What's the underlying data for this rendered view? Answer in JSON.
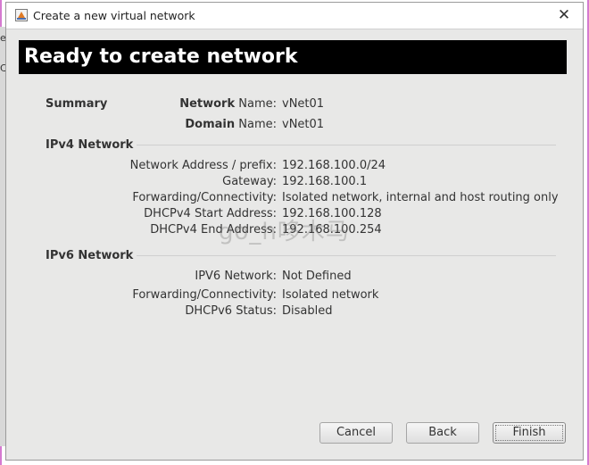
{
  "window": {
    "title": "Create a new virtual network",
    "close_glyph": "✕"
  },
  "behind": {
    "chars": [
      "e",
      "C",
      "(",
      "a",
      "t"
    ]
  },
  "header": {
    "title": "Ready to create network"
  },
  "summary": {
    "section": "Summary",
    "network_label_bold": "Network",
    "network_label_rest": " Name:",
    "network_name": "vNet01",
    "domain_label_bold": "Domain",
    "domain_label_rest": " Name:",
    "domain_name": "vNet01"
  },
  "ipv4": {
    "section": "IPv4 Network",
    "rows": [
      {
        "label": "Network Address / prefix:",
        "value": "192.168.100.0/24"
      },
      {
        "label": "Gateway:",
        "value": "192.168.100.1"
      },
      {
        "label": "Forwarding/Connectivity:",
        "value": "Isolated network, internal and host routing only"
      },
      {
        "label": "DHCPv4 Start Address:",
        "value": "192.168.100.128"
      },
      {
        "label": "DHCPv4 End Address:",
        "value": "192.168.100.254"
      }
    ]
  },
  "ipv6": {
    "section": "IPv6 Network",
    "rows": [
      {
        "label": "IPV6 Network:",
        "value": "Not Defined"
      },
      {
        "label": "Forwarding/Connectivity:",
        "value": "Isolated network"
      },
      {
        "label": "DHCPv6 Status:",
        "value": "Disabled"
      }
    ]
  },
  "buttons": {
    "cancel": "Cancel",
    "back": "Back",
    "finish": "Finish"
  },
  "watermark": "go_h哆木马",
  "colors": {
    "banner_bg": "#000000",
    "banner_fg": "#ffffff",
    "dialog_bg": "#e8e8e7",
    "page_edge": "#d57ad0"
  }
}
